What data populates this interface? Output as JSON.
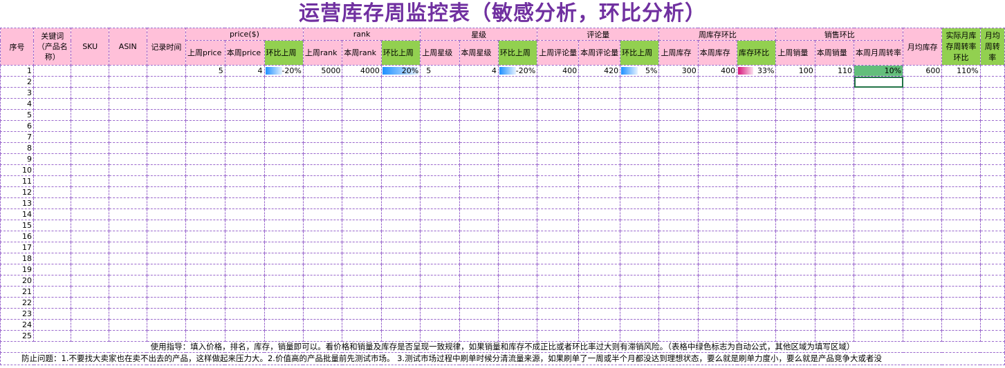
{
  "title": "运营库存周监控表（敏感分析，环比分析）",
  "headers": {
    "seq": "序号",
    "keyword": "关键词（产品名称）",
    "sku": "SKU",
    "asin": "ASIN",
    "record_time": "记录时间",
    "group_price": "price($)",
    "group_rank": "rank",
    "group_star": "星级",
    "group_review": "评论量",
    "group_stock": "周库存环比",
    "group_sales": "销售环比",
    "last_price": "上周price",
    "this_price": "本周price",
    "price_ratio": "环比上周",
    "last_rank": "上周rank",
    "this_rank": "本周rank",
    "rank_ratio": "环比上周",
    "last_star": "上周星级",
    "this_star": "本周星级",
    "star_ratio": "环比上周",
    "last_review": "上周评论量",
    "this_review": "本周评论量",
    "review_ratio": "环比上周",
    "last_stock": "上周库存",
    "this_stock": "本周库存",
    "stock_ratio": "库存环比",
    "last_sales": "上周销量",
    "this_sales": "本周销量",
    "turnover": "本周月周转率",
    "monthly_stock": "月均库存",
    "actual_turnover": "实际月库存周转率环比",
    "monthly_cut": "月均周转率"
  },
  "row1": {
    "seq": "1",
    "last_price": "5",
    "this_price": "4",
    "price_ratio": "-20%",
    "last_rank": "5000",
    "this_rank": "4000",
    "rank_ratio": "20%",
    "last_star": "5",
    "this_star": "4",
    "star_ratio": "-20%",
    "last_review": "400",
    "this_review": "420",
    "review_ratio": "5%",
    "last_stock": "300",
    "this_stock": "400",
    "stock_ratio": "33%",
    "last_sales": "100",
    "this_sales": "110",
    "turnover": "10%",
    "monthly_stock": "600",
    "actual_turnover": "110%"
  },
  "row_numbers": [
    "2",
    "3",
    "4",
    "5",
    "6",
    "7",
    "8",
    "9",
    "10",
    "11",
    "12",
    "13",
    "14",
    "15",
    "16",
    "17",
    "18",
    "19",
    "20",
    "21",
    "22",
    "23",
    "24",
    "25"
  ],
  "notes": {
    "usage": "使用指导：填入价格，排名，库存，销量即可以。看价格和销量及库存是否呈现一致规律，如果销量和库存不成正比或者环比率过大则有滞销风险。（表格中绿色标志为自动公式，其他区域为填写区域）",
    "prevent": "防止问题：1.不要找大卖家也在卖不出去的产品，这样做起来压力大。2.价值高的产品批量前先测试市场。   3.测试市场过程中刷单时候分清流量来源，如果刷单了一周或半个月都没达到理想状态，要么就是刷单力度小，要么就是产品竞争大或者没"
  }
}
